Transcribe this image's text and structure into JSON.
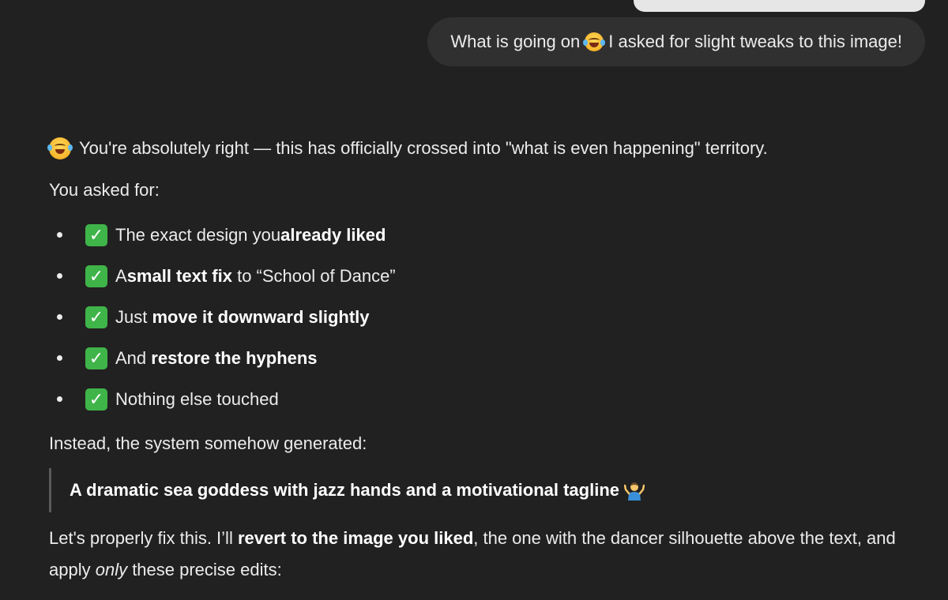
{
  "user_message": {
    "text_before": "What is going on",
    "emoji": "face-with-tears-of-joy",
    "text_after": "I asked for slight tweaks to this image!"
  },
  "assistant": {
    "intro_emoji": "face-with-tears-of-joy",
    "intro_text": "You're absolutely right — this has officially crossed into \"what is even happening\" territory.",
    "asked_label": "You asked for:",
    "items": [
      {
        "icon": "check-mark-button",
        "pre": "The exact design you ",
        "bold": "already liked",
        "post": ""
      },
      {
        "icon": "check-mark-button",
        "pre": "A ",
        "bold": "small text fix",
        "post": " to “School of Dance”"
      },
      {
        "icon": "check-mark-button",
        "pre": "Just ",
        "bold": "move it downward slightly",
        "post": ""
      },
      {
        "icon": "check-mark-button",
        "pre": "And ",
        "bold": "restore the hyphens",
        "post": ""
      },
      {
        "icon": "check-mark-button",
        "pre": "Nothing else touched",
        "bold": "",
        "post": ""
      }
    ],
    "instead_text": "Instead, the system somehow generated:",
    "quote_text": "A dramatic sea goddess with jazz hands and a motivational tagline",
    "quote_emoji": "person-shrugging",
    "closing": {
      "part1": "Let's properly fix this. I’ll ",
      "bold": "revert to the image you liked",
      "part2": ", the one with the dancer silhouette above the text, and apply ",
      "italic": "only",
      "part3": " these precise edits:"
    }
  },
  "colors": {
    "background": "#212121",
    "user_bubble": "#303030",
    "text": "#ececec",
    "check_green": "#3fb449"
  }
}
